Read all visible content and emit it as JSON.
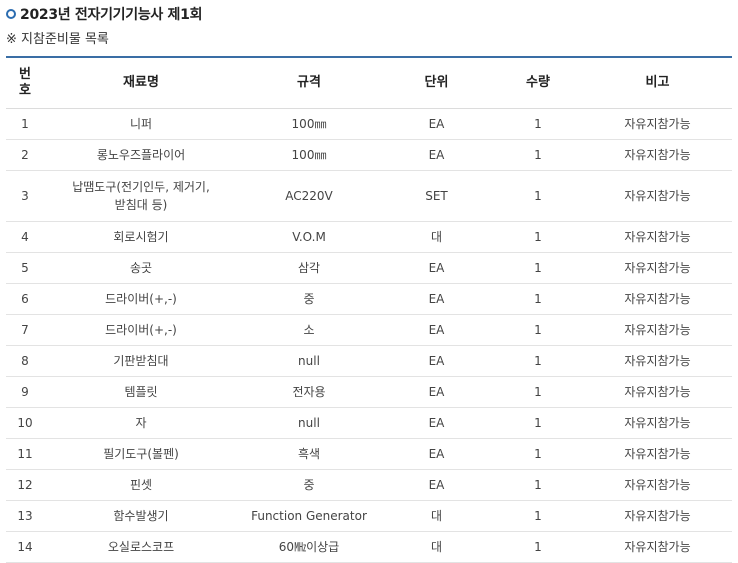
{
  "header": {
    "title": "2023년 전자기기기능사 제1회",
    "subtitle": "※ 지참준비물 목록"
  },
  "table": {
    "columns": [
      "번호",
      "재료명",
      "규격",
      "단위",
      "수량",
      "비고"
    ],
    "rows": [
      [
        "1",
        "니퍼",
        "100㎜",
        "EA",
        "1",
        "자유지참가능"
      ],
      [
        "2",
        "롱노우즈플라이어",
        "100㎜",
        "EA",
        "1",
        "자유지참가능"
      ],
      [
        "3",
        "납땜도구(전기인두, 제거기, 받침대 등)",
        "AC220V",
        "SET",
        "1",
        "자유지참가능"
      ],
      [
        "4",
        "회로시험기",
        "V.O.M",
        "대",
        "1",
        "자유지참가능"
      ],
      [
        "5",
        "송곳",
        "삼각",
        "EA",
        "1",
        "자유지참가능"
      ],
      [
        "6",
        "드라이버(+,-)",
        "중",
        "EA",
        "1",
        "자유지참가능"
      ],
      [
        "7",
        "드라이버(+,-)",
        "소",
        "EA",
        "1",
        "자유지참가능"
      ],
      [
        "8",
        "기판받침대",
        "null",
        "EA",
        "1",
        "자유지참가능"
      ],
      [
        "9",
        "템플릿",
        "전자용",
        "EA",
        "1",
        "자유지참가능"
      ],
      [
        "10",
        "자",
        "null",
        "EA",
        "1",
        "자유지참가능"
      ],
      [
        "11",
        "필기도구(볼펜)",
        "흑색",
        "EA",
        "1",
        "자유지참가능"
      ],
      [
        "12",
        "핀셋",
        "중",
        "EA",
        "1",
        "자유지참가능"
      ],
      [
        "13",
        "함수발생기",
        "Function Generator",
        "대",
        "1",
        "자유지참가능"
      ],
      [
        "14",
        "오실로스코프",
        "60㎒이상급",
        "대",
        "1",
        "자유지참가능"
      ]
    ]
  },
  "colors": {
    "accent": "#3a6ea5",
    "bullet": "#2b6cb0"
  }
}
